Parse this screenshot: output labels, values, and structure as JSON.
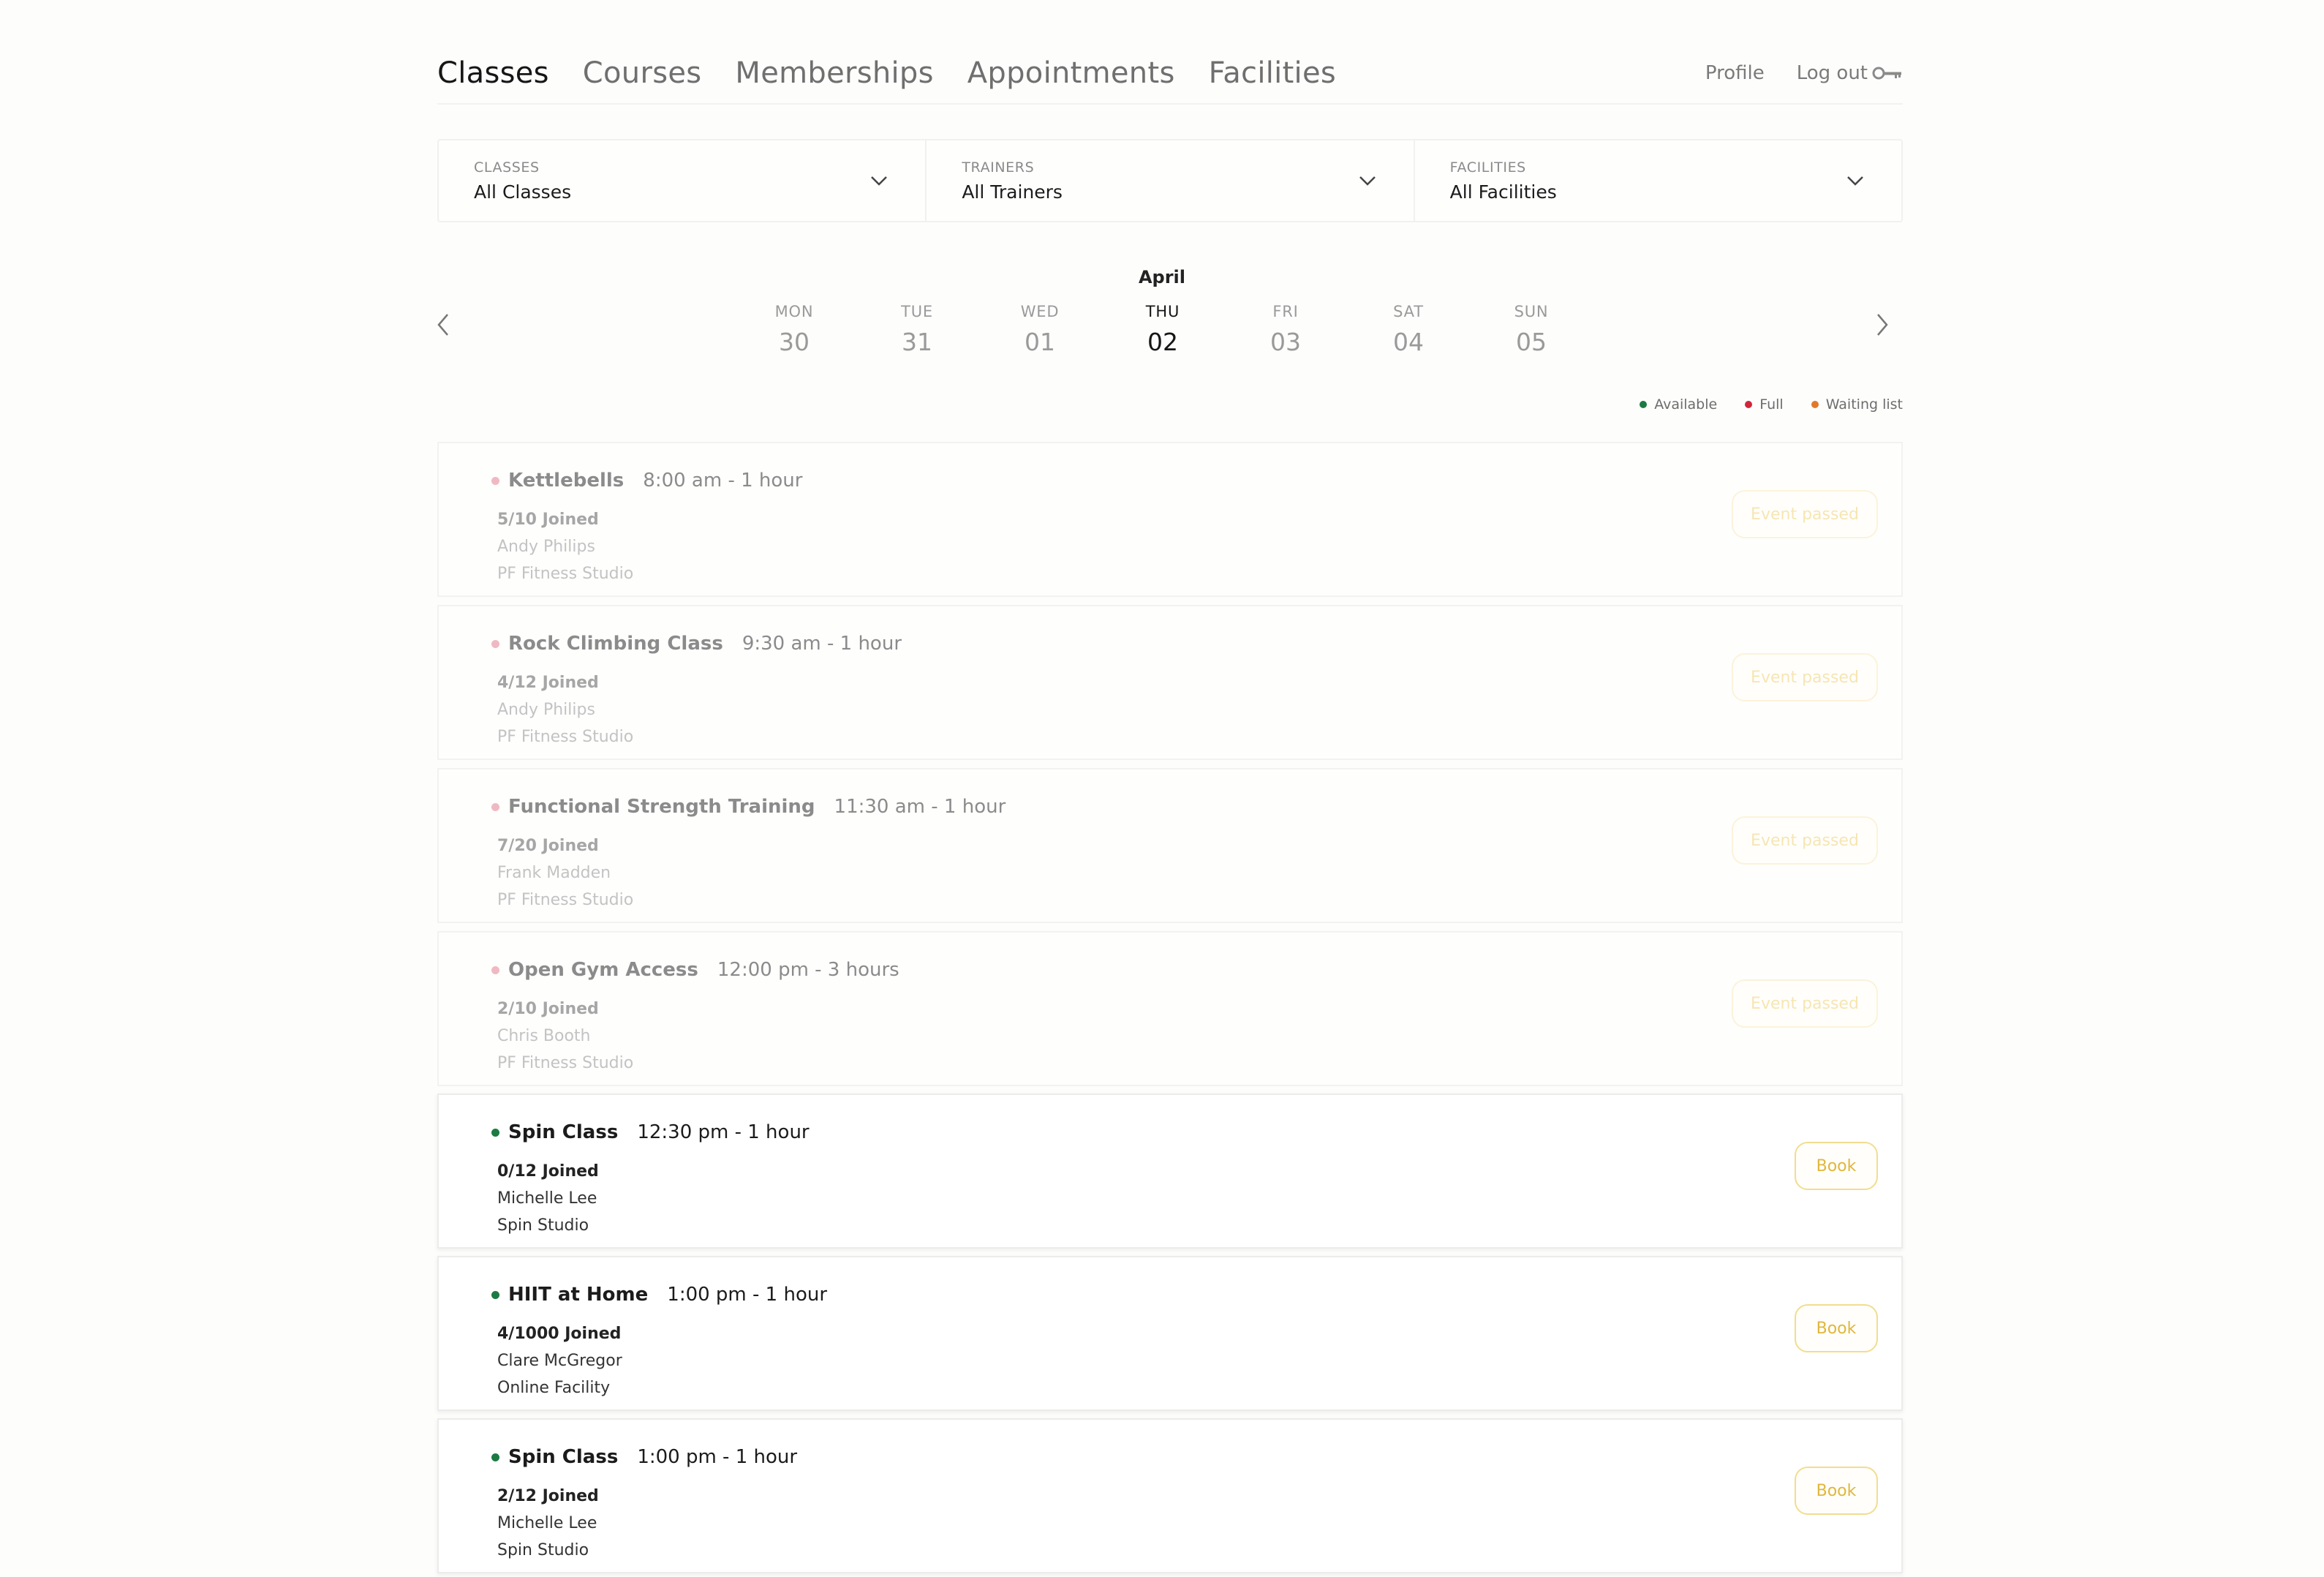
{
  "nav": {
    "tabs": [
      "Classes",
      "Courses",
      "Memberships",
      "Appointments",
      "Facilities"
    ],
    "profile": "Profile",
    "logout": "Log out"
  },
  "filters": {
    "classes": {
      "label": "CLASSES",
      "value": "All Classes"
    },
    "trainers": {
      "label": "TRAINERS",
      "value": "All Trainers"
    },
    "facilities": {
      "label": "FACILITIES",
      "value": "All Facilities"
    }
  },
  "calendar": {
    "month": "April",
    "days": [
      {
        "name": "MON",
        "num": "30"
      },
      {
        "name": "TUE",
        "num": "31"
      },
      {
        "name": "WED",
        "num": "01"
      },
      {
        "name": "THU",
        "num": "02"
      },
      {
        "name": "FRI",
        "num": "03"
      },
      {
        "name": "SAT",
        "num": "04"
      },
      {
        "name": "SUN",
        "num": "05"
      }
    ],
    "active_day": "THU"
  },
  "legend": [
    {
      "label": "Available",
      "color": "#1d7a43"
    },
    {
      "label": "Full",
      "color": "#d0263b"
    },
    {
      "label": "Waiting list",
      "color": "#e07a2a"
    }
  ],
  "colors": {
    "available": "#1d7a43",
    "past_dot": "#f0b9c2",
    "accent": "#e0b73c"
  },
  "classes": [
    {
      "name": "Kettlebells",
      "time": "8:00 am - 1 hour",
      "joined": "5/10 Joined",
      "trainer": "Andy Philips",
      "facility": "PF Fitness Studio",
      "button": "Event passed",
      "past": true
    },
    {
      "name": "Rock Climbing Class",
      "time": "9:30 am - 1 hour",
      "joined": "4/12 Joined",
      "trainer": "Andy Philips",
      "facility": "PF Fitness Studio",
      "button": "Event passed",
      "past": true
    },
    {
      "name": "Functional Strength Training",
      "time": "11:30 am - 1 hour",
      "joined": "7/20 Joined",
      "trainer": "Frank Madden",
      "facility": "PF Fitness Studio",
      "button": "Event passed",
      "past": true
    },
    {
      "name": "Open Gym Access",
      "time": "12:00 pm - 3 hours",
      "joined": "2/10 Joined",
      "trainer": "Chris Booth",
      "facility": "PF Fitness Studio",
      "button": "Event passed",
      "past": true
    },
    {
      "name": "Spin Class",
      "time": "12:30 pm - 1 hour",
      "joined": "0/12 Joined",
      "trainer": "Michelle Lee",
      "facility": "Spin Studio",
      "button": "Book",
      "past": false
    },
    {
      "name": "HIIT at Home",
      "time": "1:00 pm - 1 hour",
      "joined": "4/1000 Joined",
      "trainer": "Clare McGregor",
      "facility": "Online Facility",
      "button": "Book",
      "past": false
    },
    {
      "name": "Spin Class",
      "time": "1:00 pm - 1 hour",
      "joined": "2/12 Joined",
      "trainer": "Michelle Lee",
      "facility": "Spin Studio",
      "button": "Book",
      "past": false
    }
  ]
}
